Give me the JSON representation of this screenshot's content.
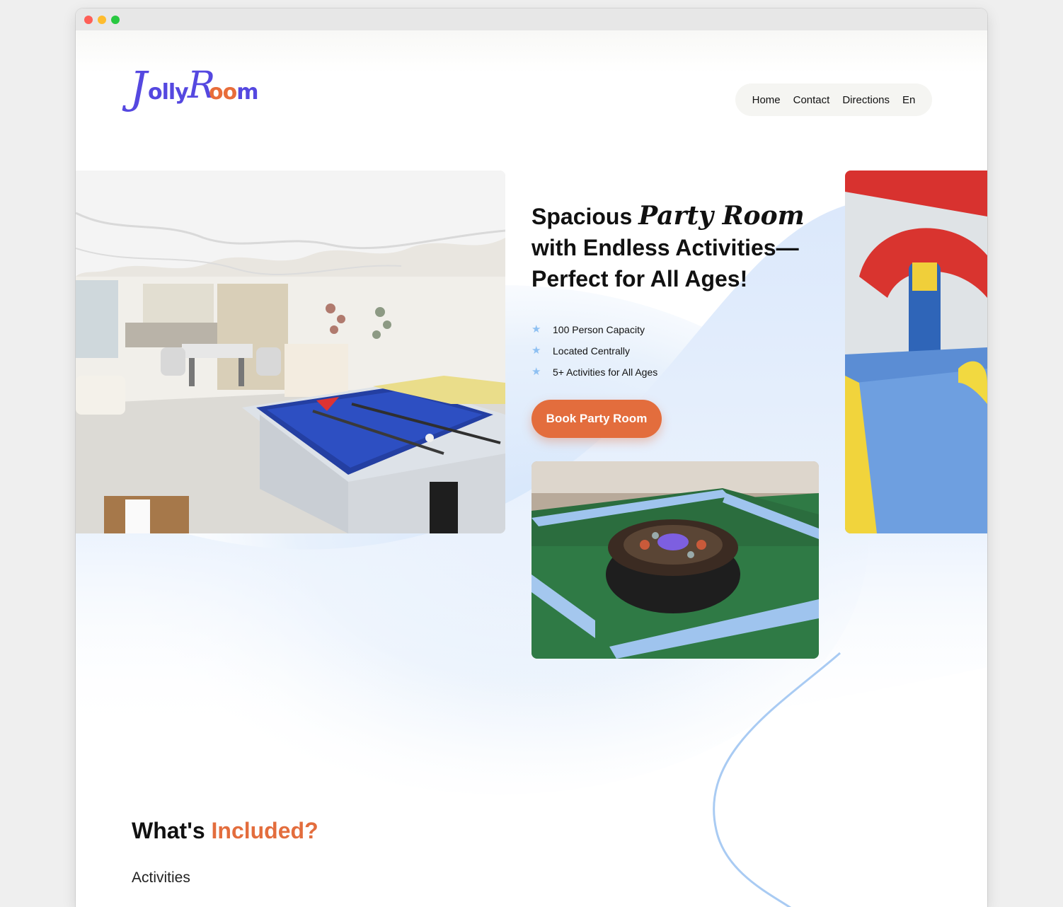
{
  "brand": {
    "logo_parts": [
      "J",
      "olly",
      "R",
      "o",
      "o",
      "m"
    ],
    "colors": {
      "primary": "#5548e0",
      "accent": "#e36d3d",
      "soft_blue": "#dce9fb"
    }
  },
  "nav": {
    "items": [
      "Home",
      "Contact",
      "Directions",
      "En"
    ]
  },
  "hero": {
    "title_lead": "Spacious",
    "title_script": "Party Room",
    "title_rest": "with Endless Activities—Perfect for All Ages!",
    "features": [
      "100 Person Capacity",
      "Located Centrally",
      "5+ Activities for All Ages"
    ],
    "feature_icon": "star-icon",
    "cta_label": "Book Party Room"
  },
  "included": {
    "title_lead": "What's",
    "title_accent": "Included?",
    "subtitle": "Activities"
  }
}
